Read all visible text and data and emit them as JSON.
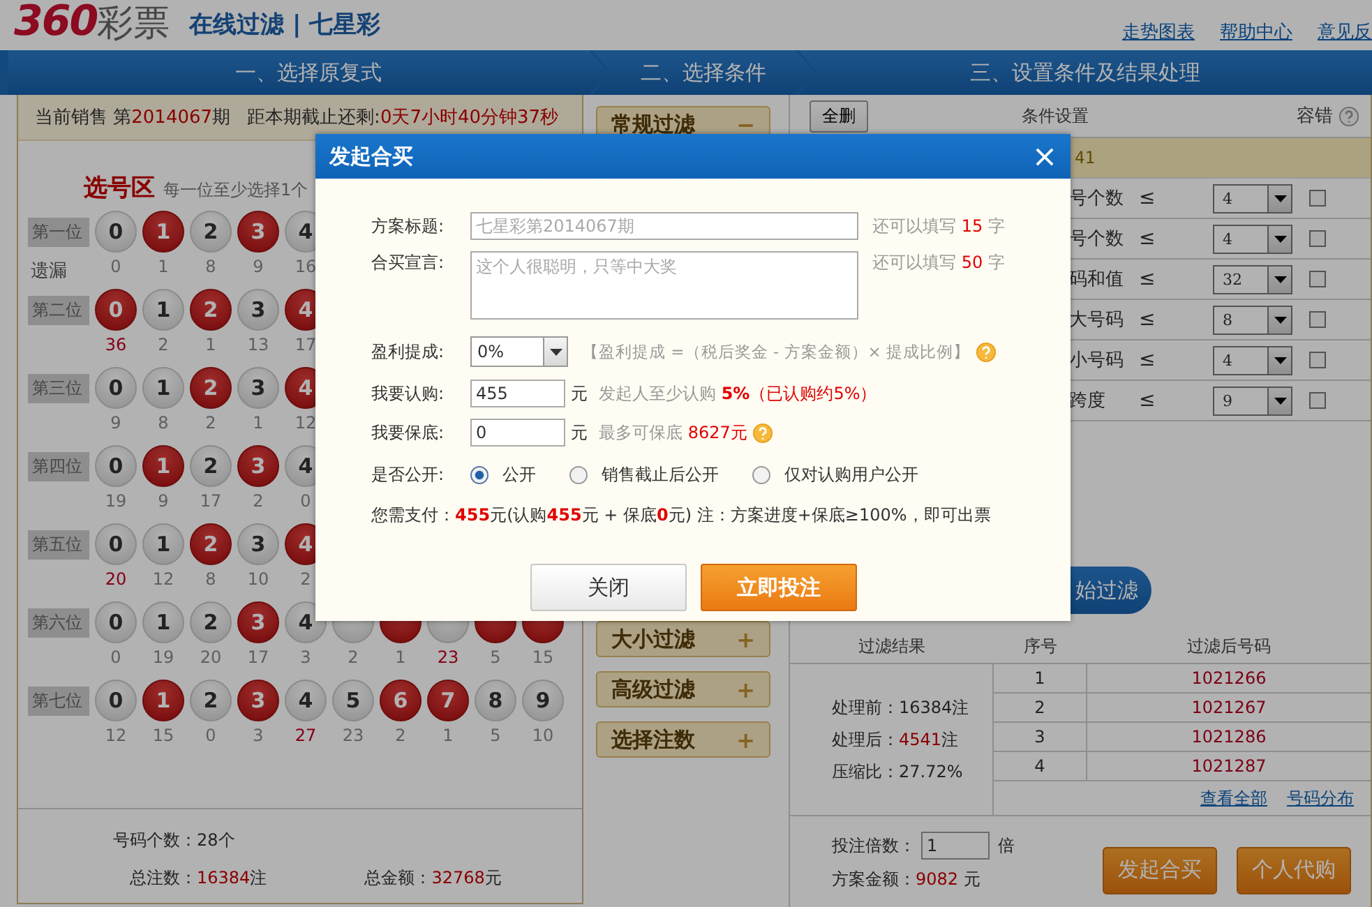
{
  "header": {
    "logo_digits": "360",
    "logo_text": "彩票",
    "title": "在线过滤 | 七星彩",
    "links": [
      "走势图表",
      "帮助中心",
      "意见反"
    ]
  },
  "steps": [
    "一、选择原复式",
    "二、选择条件",
    "三、设置条件及结果处理"
  ],
  "sale_info": {
    "label": "当前销售 第",
    "issue": "2014067",
    "suffix": "期",
    "deadline_label": "距本期截止还剩:",
    "countdown": "0天7小时40分钟37秒"
  },
  "picker": {
    "title": "选号区",
    "hint": "每一位至少选择1个",
    "miss_label": "遗漏",
    "positions": [
      {
        "label": "第一位",
        "balls": [
          {
            "number": "0",
            "selected": false,
            "miss": "0",
            "hot": false
          },
          {
            "number": "1",
            "selected": true,
            "miss": "1",
            "hot": false
          },
          {
            "number": "2",
            "selected": false,
            "miss": "8",
            "hot": false
          },
          {
            "number": "3",
            "selected": true,
            "miss": "9",
            "hot": false
          },
          {
            "number": "4",
            "selected": false,
            "miss": "16",
            "hot": false
          }
        ]
      },
      {
        "label": "第二位",
        "balls": [
          {
            "number": "0",
            "selected": true,
            "miss": "36",
            "hot": true
          },
          {
            "number": "1",
            "selected": false,
            "miss": "2",
            "hot": false
          },
          {
            "number": "2",
            "selected": true,
            "miss": "1",
            "hot": false
          },
          {
            "number": "3",
            "selected": false,
            "miss": "13",
            "hot": false
          },
          {
            "number": "4",
            "selected": true,
            "miss": "17",
            "hot": false
          }
        ]
      },
      {
        "label": "第三位",
        "balls": [
          {
            "number": "0",
            "selected": false,
            "miss": "9",
            "hot": false
          },
          {
            "number": "1",
            "selected": false,
            "miss": "8",
            "hot": false
          },
          {
            "number": "2",
            "selected": true,
            "miss": "2",
            "hot": false
          },
          {
            "number": "3",
            "selected": false,
            "miss": "1",
            "hot": false
          },
          {
            "number": "4",
            "selected": true,
            "miss": "12",
            "hot": false
          }
        ]
      },
      {
        "label": "第四位",
        "balls": [
          {
            "number": "0",
            "selected": false,
            "miss": "19",
            "hot": false
          },
          {
            "number": "1",
            "selected": true,
            "miss": "9",
            "hot": false
          },
          {
            "number": "2",
            "selected": false,
            "miss": "17",
            "hot": false
          },
          {
            "number": "3",
            "selected": true,
            "miss": "2",
            "hot": false
          },
          {
            "number": "4",
            "selected": false,
            "miss": "0",
            "hot": false
          }
        ]
      },
      {
        "label": "第五位",
        "balls": [
          {
            "number": "0",
            "selected": false,
            "miss": "20",
            "hot": true
          },
          {
            "number": "1",
            "selected": false,
            "miss": "12",
            "hot": false
          },
          {
            "number": "2",
            "selected": true,
            "miss": "8",
            "hot": false
          },
          {
            "number": "3",
            "selected": false,
            "miss": "10",
            "hot": false
          },
          {
            "number": "4",
            "selected": true,
            "miss": "2",
            "hot": false
          }
        ]
      },
      {
        "label": "第六位",
        "balls": [
          {
            "number": "0",
            "selected": false,
            "miss": "0",
            "hot": false
          },
          {
            "number": "1",
            "selected": false,
            "miss": "19",
            "hot": false
          },
          {
            "number": "2",
            "selected": false,
            "miss": "20",
            "hot": false
          },
          {
            "number": "3",
            "selected": true,
            "miss": "17",
            "hot": false
          },
          {
            "number": "4",
            "selected": false,
            "miss": "3",
            "hot": false
          },
          {
            "selected": false,
            "miss": "2",
            "hot": false
          },
          {
            "selected": true,
            "miss": "1",
            "hot": false
          },
          {
            "selected": false,
            "miss": "23",
            "hot": true
          },
          {
            "selected": true,
            "miss": "5",
            "hot": false
          },
          {
            "selected": true,
            "miss": "15",
            "hot": false
          }
        ]
      },
      {
        "label": "第七位",
        "balls": [
          {
            "number": "0",
            "selected": false,
            "miss": "12",
            "hot": false
          },
          {
            "number": "1",
            "selected": true,
            "miss": "15",
            "hot": false
          },
          {
            "number": "2",
            "selected": false,
            "miss": "0",
            "hot": false
          },
          {
            "number": "3",
            "selected": true,
            "miss": "3",
            "hot": false
          },
          {
            "number": "4",
            "selected": false,
            "miss": "27",
            "hot": true
          },
          {
            "number": "5",
            "selected": false,
            "miss": "23",
            "hot": false
          },
          {
            "number": "6",
            "selected": true,
            "miss": "2",
            "hot": false
          },
          {
            "number": "7",
            "selected": true,
            "miss": "1",
            "hot": false
          },
          {
            "number": "8",
            "selected": false,
            "miss": "5",
            "hot": false
          },
          {
            "number": "9",
            "selected": false,
            "miss": "10",
            "hot": false
          }
        ]
      }
    ]
  },
  "summary": {
    "count_label": "号码个数：",
    "count": "28个",
    "bets_label": "总注数：",
    "bets": "16384",
    "bets_unit": "注",
    "amount_label": "总金额：",
    "amount": "32768",
    "amount_unit": "元"
  },
  "filter_groups": [
    {
      "label": "常规过滤",
      "sign": "−"
    },
    {
      "label": "大小过滤",
      "sign": "+"
    },
    {
      "label": "高级过滤",
      "sign": "+"
    },
    {
      "label": "选择注数",
      "sign": "+"
    }
  ],
  "conditions": {
    "delete_all": "全删",
    "heading": "条件设置",
    "tolerance": "容错",
    "banner": "41",
    "rows": [
      {
        "name": "号个数",
        "op": "≤",
        "value": "4",
        "checked": false
      },
      {
        "name": "号个数",
        "op": "≤",
        "value": "4",
        "checked": false
      },
      {
        "name": "码和值",
        "op": "≤",
        "value": "32",
        "checked": false
      },
      {
        "name": "大号码",
        "op": "≤",
        "value": "8",
        "checked": false
      },
      {
        "name": "小号码",
        "op": "≤",
        "value": "4",
        "checked": false
      },
      {
        "name": "跨度",
        "op": "≤",
        "value": "9",
        "checked": false
      }
    ]
  },
  "start_button": "始过滤",
  "results": {
    "columns": [
      "过滤结果",
      "序号",
      "过滤后号码"
    ],
    "stats": [
      {
        "label": "处理前：",
        "value": "16384",
        "unit": "注",
        "hot": false
      },
      {
        "label": "处理后：",
        "value": "4541",
        "unit": "注",
        "hot": true
      },
      {
        "label": "压缩比：",
        "value": "27.72%",
        "hot": false
      }
    ],
    "rows": [
      {
        "index": "1",
        "code": "1021266"
      },
      {
        "index": "2",
        "code": "1021267"
      },
      {
        "index": "3",
        "code": "1021286"
      },
      {
        "index": "4",
        "code": "1021287"
      }
    ],
    "links": [
      "查看全部",
      "号码分布"
    ]
  },
  "bet": {
    "multiple_label": "投注倍数：",
    "multiple": "1",
    "multiple_unit": "倍",
    "amount_label": "方案金额：",
    "amount": "9082",
    "amount_unit": " 元",
    "buttons": [
      "发起合买",
      "个人代购"
    ]
  },
  "dialog": {
    "title": "发起合买",
    "plan_title": {
      "label": "方案标题:",
      "placeholder": "七星彩第2014067期",
      "hint": "还可以填写",
      "remaining": "15",
      "unit": "字"
    },
    "slogan": {
      "label": "合买宣言:",
      "placeholder": "这个人很聪明，只等中大奖",
      "hint": "还可以填写",
      "remaining": "50",
      "unit": "字"
    },
    "commission": {
      "label": "盈利提成:",
      "value": "0%",
      "formula": "【盈利提成 =（税后奖金 - 方案金额）× 提成比例】"
    },
    "subscribe": {
      "label": "我要认购:",
      "value": "455",
      "unit": "元",
      "hint": "发起人至少认购",
      "min": "5%",
      "bought": "（已认购约5%）"
    },
    "guarantee": {
      "label": "我要保底:",
      "value": "0",
      "unit": "元",
      "hint": "最多可保底",
      "max": "8627元"
    },
    "visibility": {
      "label": "是否公开:",
      "options": [
        {
          "label": "公开",
          "selected": true
        },
        {
          "label": "销售截止后公开",
          "selected": false
        },
        {
          "label": "仅对认购用户公开",
          "selected": false
        }
      ]
    },
    "payment": "您需支付：**455**元(认购**455**元 + 保底**0**元) 注：方案进度+保底≥100%，即可出票",
    "buttons": [
      {
        "label": "关闭",
        "kind": "secondary"
      },
      {
        "label": "立即投注",
        "kind": "primary"
      }
    ]
  }
}
